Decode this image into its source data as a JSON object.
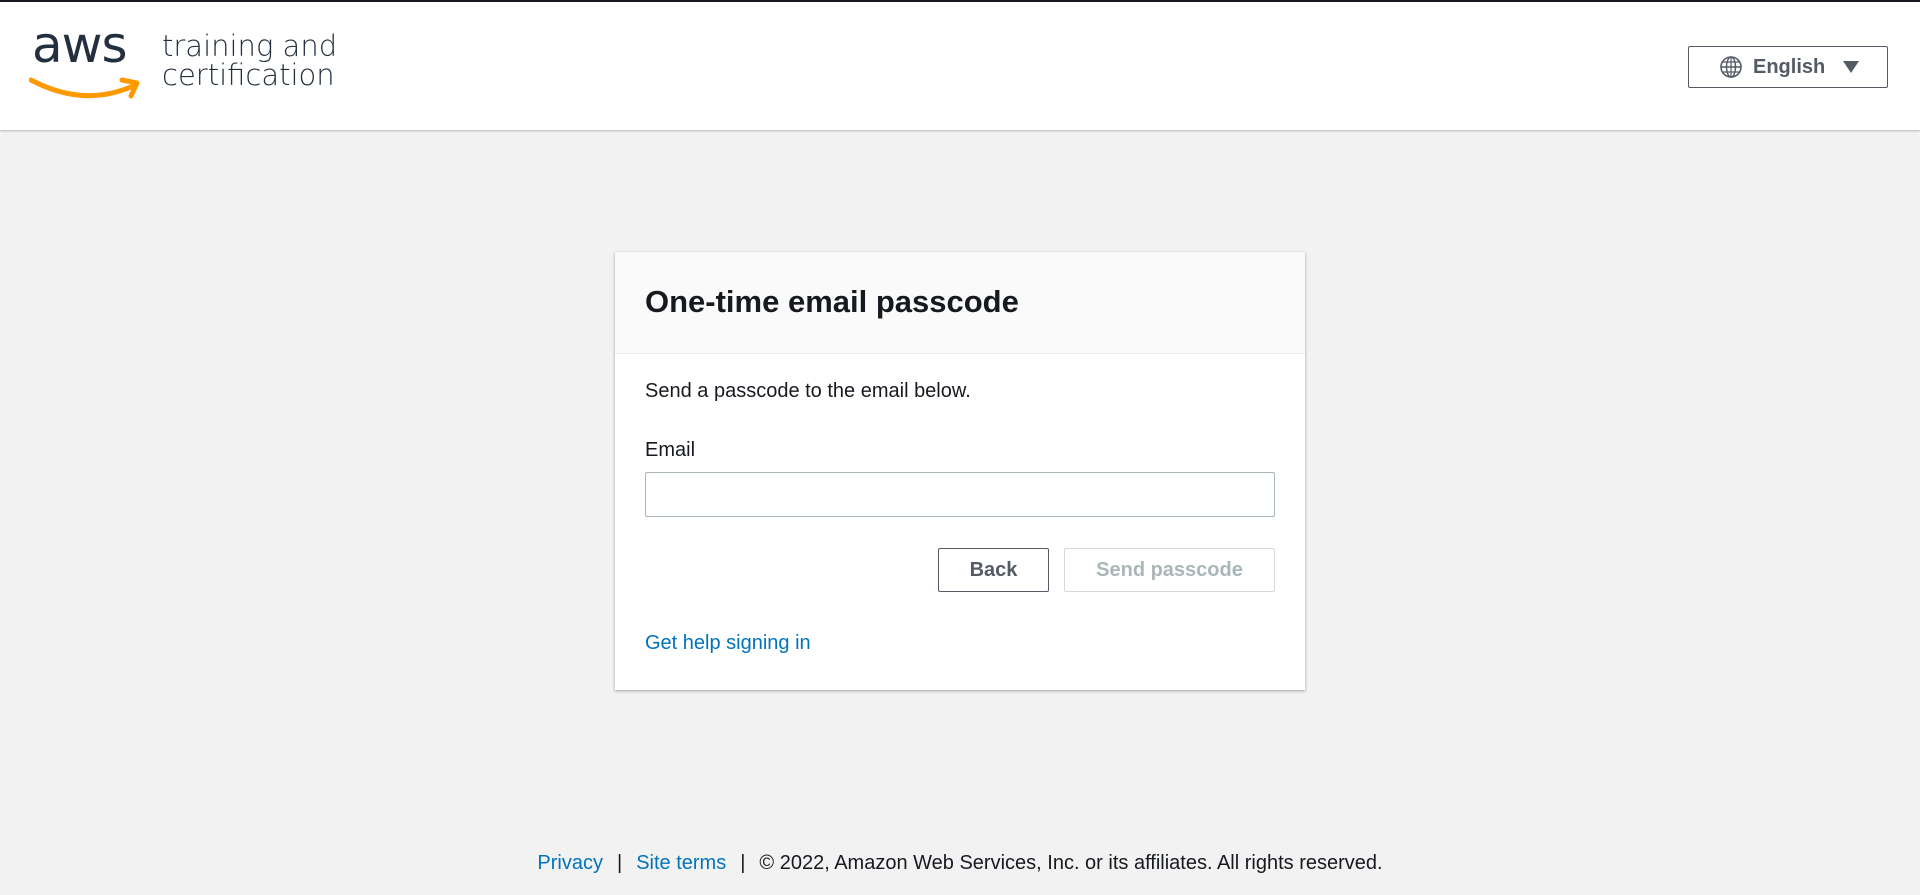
{
  "header": {
    "logo": {
      "wordmark": "aws",
      "subtitle_line1": "training and",
      "subtitle_line2": "certification"
    },
    "language_selector": {
      "icon": "globe-icon",
      "label": "English",
      "caret_icon": "caret-down-icon"
    }
  },
  "card": {
    "title": "One-time email passcode",
    "description": "Send a passcode to the email below.",
    "email_label": "Email",
    "email_value": "",
    "back_label": "Back",
    "send_label": "Send passcode",
    "help_link": "Get help signing in"
  },
  "footer": {
    "privacy": "Privacy",
    "separator": "|",
    "site_terms": "Site terms",
    "copyright": "© 2022, Amazon Web Services, Inc. or its affiliates. All rights reserved."
  },
  "colors": {
    "page_background": "#f2f2f2",
    "link": "#0073bb",
    "brand_orange": "#ff9900",
    "brand_navy": "#232f3e",
    "disabled_text": "#aab7b8"
  }
}
